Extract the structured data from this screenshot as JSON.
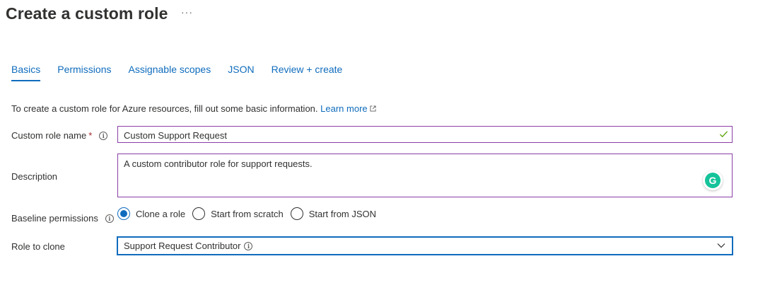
{
  "header": {
    "title": "Create a custom role",
    "more_label": "···"
  },
  "tabs": [
    {
      "label": "Basics",
      "active": true
    },
    {
      "label": "Permissions",
      "active": false
    },
    {
      "label": "Assignable scopes",
      "active": false
    },
    {
      "label": "JSON",
      "active": false
    },
    {
      "label": "Review + create",
      "active": false
    }
  ],
  "intro": {
    "text": "To create a custom role for Azure resources, fill out some basic information.",
    "link_label": "Learn more",
    "link_icon": "external-link-icon"
  },
  "form": {
    "name": {
      "label": "Custom role name",
      "required_mark": "*",
      "value": "Custom Support Request",
      "valid_icon": "checkmark-icon",
      "info_icon": "info-icon"
    },
    "description": {
      "label": "Description",
      "value": "A custom contributor role for support requests.",
      "assistant_icon": "grammarly-icon",
      "assistant_letter": "G"
    },
    "baseline": {
      "label": "Baseline permissions",
      "info_icon": "info-icon",
      "options": [
        {
          "label": "Clone a role",
          "checked": true
        },
        {
          "label": "Start from scratch",
          "checked": false
        },
        {
          "label": "Start from JSON",
          "checked": false
        }
      ]
    },
    "role_to_clone": {
      "label": "Role to clone",
      "value": "Support Request Contributor",
      "info_icon": "info-icon",
      "chevron_icon": "chevron-down-icon"
    }
  },
  "colors": {
    "accent": "#0f6cbd",
    "input_border": "#8a3ea6",
    "required": "#a4262c",
    "valid": "#57a300",
    "grammarly": "#15c39a"
  }
}
